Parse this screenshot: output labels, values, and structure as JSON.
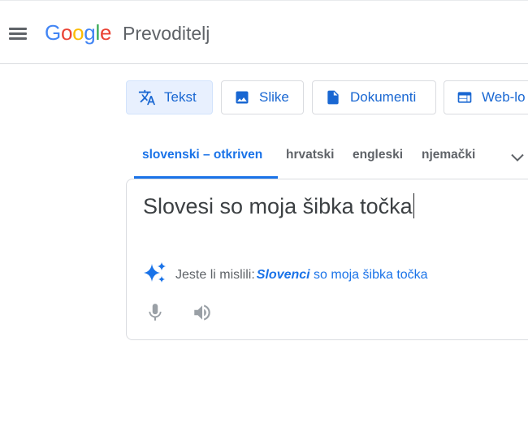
{
  "header": {
    "logo_text": "Google",
    "product": "Prevoditelj"
  },
  "modes": [
    {
      "label": "Tekst",
      "icon": "translate-icon",
      "active": true
    },
    {
      "label": "Slike",
      "icon": "image-icon",
      "active": false
    },
    {
      "label": "Dokumenti",
      "icon": "document-icon",
      "active": false
    },
    {
      "label": "Web-lo",
      "icon": "website-icon",
      "active": false
    }
  ],
  "languages": {
    "tabs": [
      "slovenski – otkriven",
      "hrvatski",
      "engleski",
      "njemački"
    ],
    "active": "slovenski – otkriven"
  },
  "source": {
    "text": "Slovesi so moja šibka točka"
  },
  "suggestion": {
    "prefix": "Jeste li mislili:",
    "corrected_word": "Slovenci",
    "rest": " so moja šibka točka"
  },
  "colors": {
    "accent": "#1a73e8",
    "mode_active_bg": "#e8f0fe",
    "border": "#dadce0",
    "muted_text": "#5f6368"
  }
}
